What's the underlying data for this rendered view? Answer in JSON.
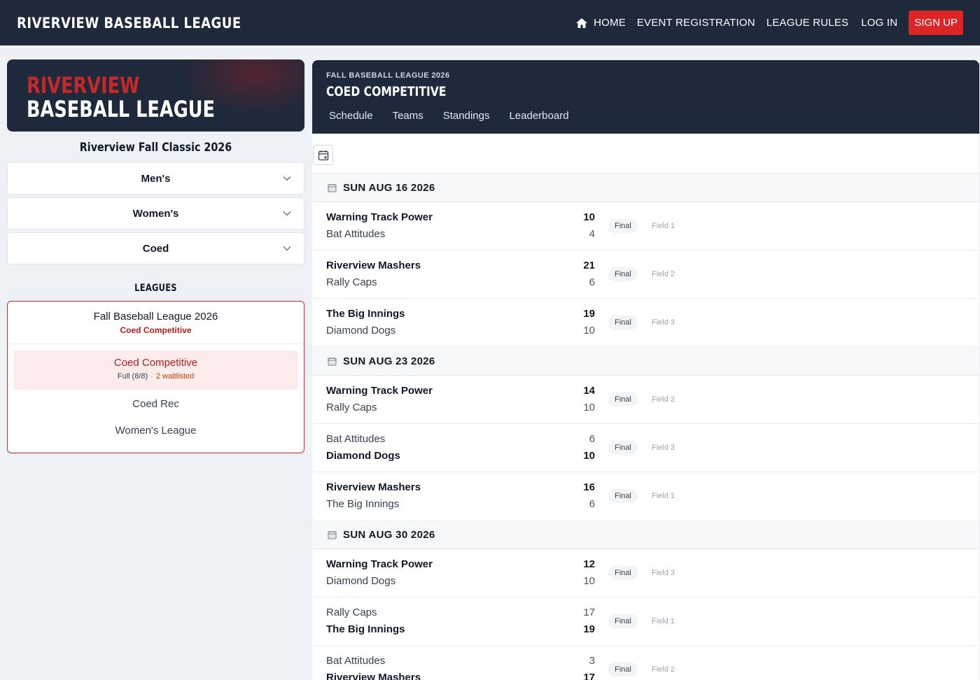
{
  "nav": {
    "brand": "RIVERVIEW BASEBALL LEAGUE",
    "home": "HOME",
    "event_registration": "EVENT REGISTRATION",
    "league_rules": "LEAGUE RULES",
    "login": "LOG IN",
    "signup": "SIGN UP"
  },
  "sidebar": {
    "hero_line1": "RIVERVIEW",
    "hero_line2": "BASEBALL LEAGUE",
    "event_title": "Riverview Fall Classic 2026",
    "divisions": [
      "Men's",
      "Women's",
      "Coed"
    ],
    "leagues_heading": "LEAGUES",
    "league": {
      "name": "Fall Baseball League 2026",
      "sub": "Coed Competitive",
      "active": {
        "name": "Coed Competitive",
        "capacity": "Full (8/8)",
        "sep": "·",
        "waitlist": "2 waitlisted"
      },
      "options": [
        "Coed Rec",
        "Women's League"
      ]
    }
  },
  "main": {
    "kicker": "FALL BASEBALL LEAGUE 2026",
    "title": "COED COMPETITIVE",
    "tabs": [
      "Schedule",
      "Teams",
      "Standings",
      "Leaderboard"
    ]
  },
  "schedule": [
    {
      "date": "SUN AUG 16 2026",
      "games": [
        {
          "team1": "Warning Track Power",
          "score1": "10",
          "team2": "Bat Attitudes",
          "score2": "4",
          "winner": 1,
          "status": "Final",
          "field": "Field 1"
        },
        {
          "team1": "Riverview Mashers",
          "score1": "21",
          "team2": "Rally Caps",
          "score2": "6",
          "winner": 1,
          "status": "Final",
          "field": "Field 2"
        },
        {
          "team1": "The Big Innings",
          "score1": "19",
          "team2": "Diamond Dogs",
          "score2": "10",
          "winner": 1,
          "status": "Final",
          "field": "Field 3"
        }
      ]
    },
    {
      "date": "SUN AUG 23 2026",
      "games": [
        {
          "team1": "Warning Track Power",
          "score1": "14",
          "team2": "Rally Caps",
          "score2": "10",
          "winner": 1,
          "status": "Final",
          "field": "Field 2"
        },
        {
          "team1": "Bat Attitudes",
          "score1": "6",
          "team2": "Diamond Dogs",
          "score2": "10",
          "winner": 2,
          "status": "Final",
          "field": "Field 3"
        },
        {
          "team1": "Riverview Mashers",
          "score1": "16",
          "team2": "The Big Innings",
          "score2": "6",
          "winner": 1,
          "status": "Final",
          "field": "Field 1"
        }
      ]
    },
    {
      "date": "SUN AUG 30 2026",
      "games": [
        {
          "team1": "Warning Track Power",
          "score1": "12",
          "team2": "Diamond Dogs",
          "score2": "10",
          "winner": 1,
          "status": "Final",
          "field": "Field 3"
        },
        {
          "team1": "Rally Caps",
          "score1": "17",
          "team2": "The Big Innings",
          "score2": "19",
          "winner": 2,
          "status": "Final",
          "field": "Field 1"
        },
        {
          "team1": "Bat Attitudes",
          "score1": "3",
          "team2": "Riverview Mashers",
          "score2": "17",
          "winner": 2,
          "status": "Final",
          "field": "Field 2"
        }
      ]
    }
  ]
}
